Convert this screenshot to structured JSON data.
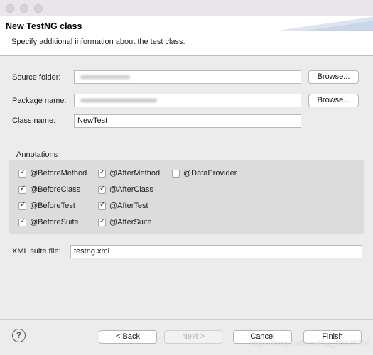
{
  "wizard": {
    "title": "New TestNG class",
    "description": "Specify additional information about the test class."
  },
  "form": {
    "source_folder_label": "Source folder:",
    "source_folder_value": "",
    "package_name_label": "Package name:",
    "package_name_value": "",
    "class_name_label": "Class name:",
    "class_name_value": "NewTest",
    "browse_label": "Browse..."
  },
  "annotations": {
    "title": "Annotations",
    "items": [
      {
        "label": "@BeforeMethod",
        "checked": true
      },
      {
        "label": "@AfterMethod",
        "checked": true
      },
      {
        "label": "@DataProvider",
        "checked": false
      },
      {
        "label": "@BeforeClass",
        "checked": true
      },
      {
        "label": "@AfterClass",
        "checked": true
      },
      {
        "label": "@BeforeTest",
        "checked": true
      },
      {
        "label": "@AfterTest",
        "checked": true
      },
      {
        "label": "@BeforeSuite",
        "checked": true
      },
      {
        "label": "@AfterSuite",
        "checked": true
      }
    ]
  },
  "xml_suite": {
    "label": "XML suite file:",
    "value": "testng.xml"
  },
  "buttons": {
    "help": "?",
    "back": "< Back",
    "next": "Next >",
    "cancel": "Cancel",
    "finish": "Finish"
  },
  "watermark": "https://blog.csdn.net/qq_32805701"
}
